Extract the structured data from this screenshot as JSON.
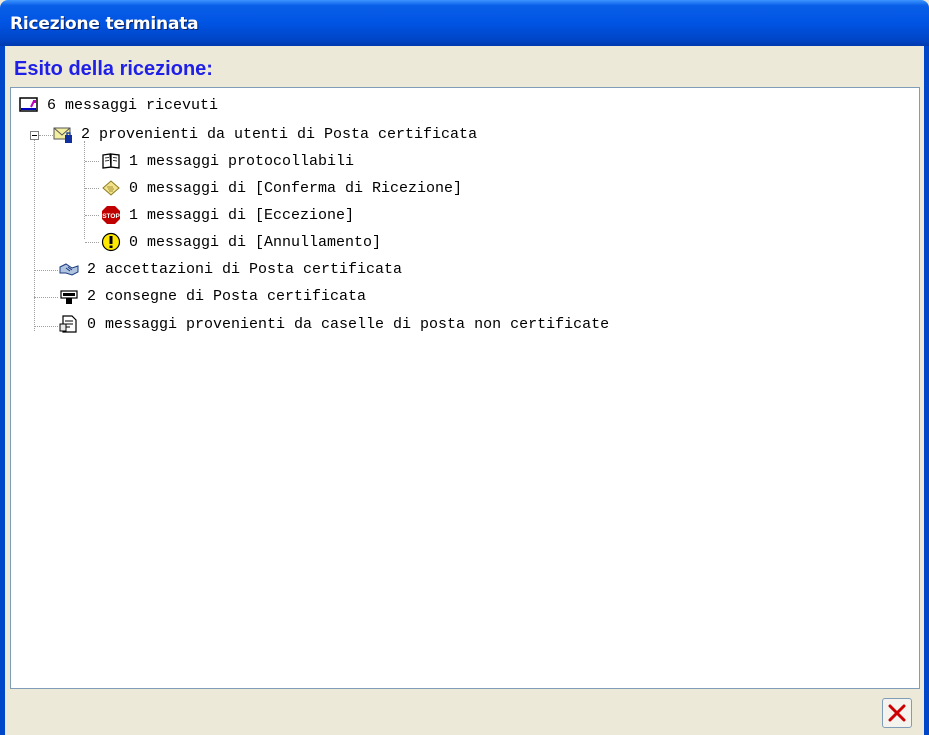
{
  "window": {
    "title": "Ricezione terminata"
  },
  "heading": "Esito della ricezione:",
  "tree": {
    "root": "6 messaggi ricevuti",
    "group1": "2 provenienti da utenti di Posta certificata",
    "group1_children": [
      "1 messaggi protocollabili",
      "0 messaggi di [Conferma di Ricezione]",
      "1 messaggi di [Eccezione]",
      "0 messaggi di [Annullamento]"
    ],
    "item_accettazioni": "2 accettazioni di Posta certificata",
    "item_consegne": "2 consegne di Posta certificata",
    "item_non_certificate": "0 messaggi provenienti da caselle di posta non certificate"
  },
  "icons": {
    "root": "inbox-icon",
    "group1": "certified-mail-icon",
    "protocollabili": "book-icon",
    "conferma": "note-icon",
    "eccezione": "stop-icon",
    "annullamento": "warning-icon",
    "accettazioni": "handshake-icon",
    "consegne": "delivery-icon",
    "non_certificate": "document-icon",
    "close": "close-icon"
  },
  "colors": {
    "titlebar": "#0054E3",
    "heading": "#1F1FE6",
    "close_x": "#CC0000"
  }
}
